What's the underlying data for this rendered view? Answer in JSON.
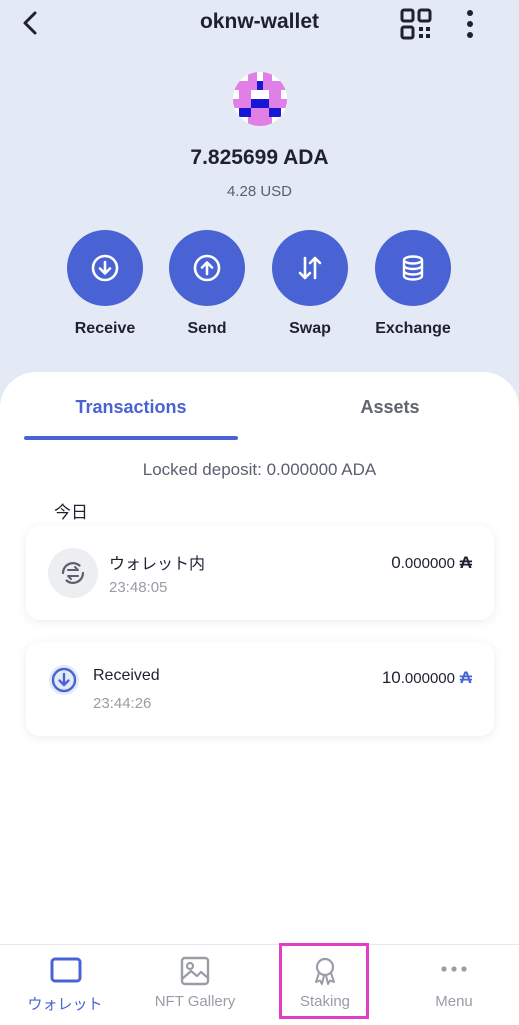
{
  "header": {
    "title": "oknw-wallet",
    "back_icon": "chevron-left-icon",
    "qr_icon": "qr-code-icon",
    "more_icon": "more-vertical-icon"
  },
  "wallet": {
    "balance": "7.825699 ADA",
    "fiat": "4.28 USD"
  },
  "actions": [
    {
      "label": "Receive",
      "icon": "arrow-down-circle-icon"
    },
    {
      "label": "Send",
      "icon": "arrow-up-circle-icon"
    },
    {
      "label": "Swap",
      "icon": "swap-arrows-icon"
    },
    {
      "label": "Exchange",
      "icon": "coin-stack-icon"
    }
  ],
  "tabs": {
    "transactions": "Transactions",
    "assets": "Assets"
  },
  "locked_deposit": "Locked deposit: 0.000000 ADA",
  "date_header": "今日",
  "transactions": [
    {
      "name": "ウォレット内",
      "time": "23:48:05",
      "amount_int": "0",
      "amount_dec": ".000000",
      "symbol": "₳",
      "icon": "swap-refresh-icon"
    },
    {
      "name": "Received",
      "time": "23:44:26",
      "amount_int": "10",
      "amount_dec": ".000000",
      "symbol": "₳",
      "icon": "arrow-down-circle-icon"
    }
  ],
  "nav": [
    {
      "label": "ウォレット",
      "icon": "wallet-icon",
      "active": true
    },
    {
      "label": "NFT Gallery",
      "icon": "image-icon",
      "active": false
    },
    {
      "label": "Staking",
      "icon": "award-ribbon-icon",
      "active": false
    },
    {
      "label": "Menu",
      "icon": "more-horizontal-icon",
      "active": false
    }
  ],
  "colors": {
    "accent": "#4a63d4",
    "header_bg": "#e4e9f6",
    "highlight": "#e23fc7",
    "inactive": "#9a9ca6"
  }
}
